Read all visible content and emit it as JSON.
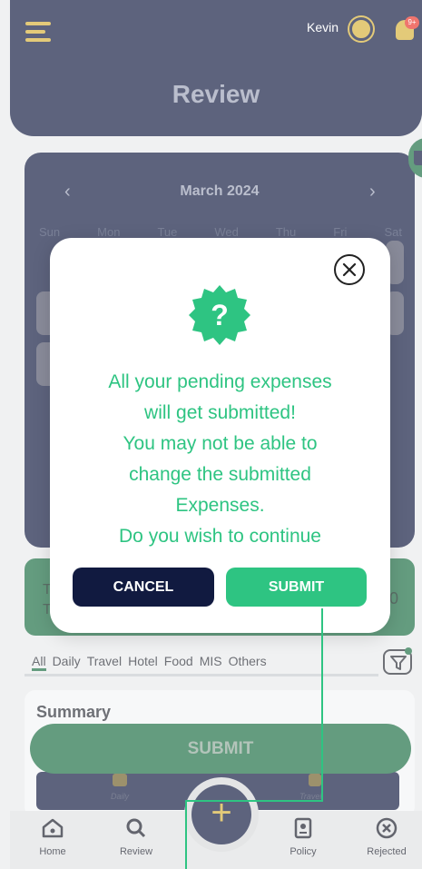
{
  "header": {
    "user_name": "Kevin",
    "notification_badge": "9+",
    "title": "Review",
    "accent": "#d6b23a",
    "bg": "#111a40"
  },
  "calendar": {
    "month": "March 2024",
    "prev": "‹",
    "next": "›",
    "days": [
      "Sun",
      "Mon",
      "Tue",
      "Wed",
      "Thu",
      "Fri",
      "Sat"
    ]
  },
  "tally": {
    "line1": "T",
    "line2": "T",
    "amount": "0"
  },
  "filters": [
    "All",
    "Daily",
    "Travel",
    "Hotel",
    "Food",
    "MIS",
    "Others"
  ],
  "summary": {
    "title": "Summary",
    "submit_label": "SUBMIT",
    "mini_daily": "Daily",
    "mini_travel": "Travel"
  },
  "bottom_nav": [
    {
      "label": "Home",
      "icon": "home-icon"
    },
    {
      "label": "Review",
      "icon": "search-icon"
    },
    {
      "label": "Policy",
      "icon": "policy-icon"
    },
    {
      "label": "Rejected",
      "icon": "rejected-icon"
    }
  ],
  "fab": {
    "label": "+"
  },
  "modal": {
    "icon": "question-badge-icon",
    "message_lines": [
      "All your pending expenses",
      "will get submitted!",
      "You may not be able to",
      "change the submitted",
      "Expenses.",
      "Do you wish to continue"
    ],
    "cancel_label": "CANCEL",
    "submit_label": "SUBMIT",
    "accent": "#2ec482"
  }
}
